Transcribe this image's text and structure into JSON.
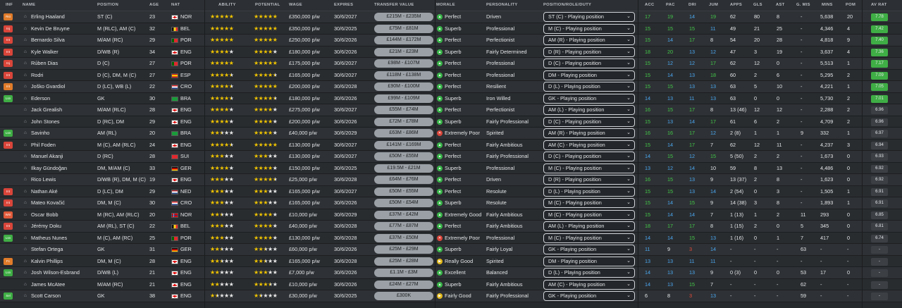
{
  "header": {
    "inf": "INF",
    "name": "NAME",
    "position": "POSITION",
    "age": "AGE",
    "nat": "NAT",
    "ability": "ABILITY",
    "potential": "POTENTIAL",
    "wage": "WAGE",
    "expires": "EXPIRES",
    "transfer_value": "TRANSFER VALUE",
    "morale": "MORALE",
    "personality": "PERSONALITY",
    "role": "POSITION/ROLE/DUTY",
    "acc": "ACC",
    "pac": "PAC",
    "dri": "DRI",
    "jum": "JUM",
    "apps": "APPS",
    "gls": "GLS",
    "ast": "AST",
    "gmis": "G. MIS",
    "mins": "MINS",
    "pom": "POM",
    "avrat": "AV RAT"
  },
  "colors": {
    "morale_green": "#3ab54a",
    "morale_red": "#d9453a",
    "morale_yellow": "#e0b81c",
    "rating_green": "#3fae45",
    "rating_light": "#7ac043"
  },
  "players": [
    {
      "inf": "Rst",
      "inf_color": "#e07b2a",
      "name": "Erling Haaland",
      "position": "ST (C)",
      "age": "23",
      "flag": "eng",
      "nat": "NOR",
      "ability": 5,
      "potential": 5,
      "wage": "£350,000 p/w",
      "expires": "30/6/2027",
      "tv": "£215M - £235M",
      "morale_icon": "green",
      "morale": "Perfect",
      "personality": "Driven",
      "role": "ST (C) - Playing position",
      "acc": "17",
      "acc_c": "g",
      "pac": "19",
      "pac_c": "g",
      "dri": "14",
      "dri_c": "b",
      "jum": "19",
      "jum_c": "g",
      "apps": "62",
      "gls": "80",
      "ast": "8",
      "gmis": "-",
      "mins": "5,638",
      "pom": "20",
      "avrat": "7.78",
      "av_c": "#3fae45"
    },
    {
      "inf": "Inj",
      "inf_color": "#d9453a",
      "name": "Kevin De Bruyne",
      "position": "M (RLC), AM (C)",
      "age": "32",
      "flag": "bel",
      "nat": "BEL",
      "ability": 5,
      "potential": 5,
      "wage": "£350,000 p/w",
      "expires": "30/6/2025",
      "tv": "£75M - £81M",
      "morale_icon": "green",
      "morale": "Superb",
      "personality": "Professional",
      "role": "M (C) - Playing position",
      "acc": "15",
      "acc_c": "g",
      "pac": "15",
      "pac_c": "g",
      "dri": "15",
      "dri_c": "g",
      "jum": "11",
      "jum_c": "b",
      "apps": "49",
      "gls": "21",
      "ast": "25",
      "gmis": "-",
      "mins": "4,346",
      "pom": "4",
      "avrat": "7.42",
      "av_c": "#3fae45"
    },
    {
      "inf": "Int",
      "inf_color": "#d9453a",
      "name": "Bernardo Silva",
      "position": "M/AM (RC)",
      "age": "29",
      "flag": "por",
      "nat": "POR",
      "ability": 5,
      "potential": 5,
      "wage": "£250,000 p/w",
      "expires": "30/6/2026",
      "tv": "£144M - £172M",
      "morale_icon": "green",
      "morale": "Perfect",
      "personality": "Perfectionist",
      "role": "AM (R) - Playing position",
      "acc": "15",
      "acc_c": "g",
      "pac": "14",
      "pac_c": "b",
      "dri": "17",
      "dri_c": "g",
      "jum": "8",
      "jum_c": "w",
      "apps": "54",
      "gls": "20",
      "ast": "28",
      "gmis": "-",
      "mins": "4,818",
      "pom": "9",
      "avrat": "7.40",
      "av_c": "#3fae45"
    },
    {
      "inf": "Int",
      "inf_color": "#d9453a",
      "name": "Kyle Walker",
      "position": "D/WB (R)",
      "age": "34",
      "flag": "eng",
      "nat": "ENG",
      "ability": 4,
      "potential": 4,
      "wage": "£180,000 p/w",
      "expires": "30/6/2026",
      "tv": "£21M - £23M",
      "morale_icon": "green",
      "morale": "Superb",
      "personality": "Fairly Determined",
      "role": "D (R) - Playing position",
      "acc": "18",
      "acc_c": "g",
      "pac": "20",
      "pac_c": "g",
      "dri": "13",
      "dri_c": "b",
      "jum": "12",
      "jum_c": "b",
      "apps": "47",
      "gls": "3",
      "ast": "19",
      "gmis": "-",
      "mins": "3,637",
      "pom": "4",
      "avrat": "7.36",
      "av_c": "#3fae45"
    },
    {
      "inf": "Inj",
      "inf_color": "#d9453a",
      "name": "Rúben Dias",
      "position": "D (C)",
      "age": "27",
      "flag": "por",
      "nat": "POR",
      "ability": 5,
      "potential": 5,
      "wage": "£175,000 p/w",
      "expires": "30/6/2027",
      "tv": "£98M - £107M",
      "morale_icon": "green",
      "morale": "Perfect",
      "personality": "Professional",
      "role": "D (C) - Playing position",
      "acc": "15",
      "acc_c": "g",
      "pac": "12",
      "pac_c": "b",
      "dri": "12",
      "dri_c": "b",
      "jum": "17",
      "jum_c": "g",
      "apps": "62",
      "gls": "12",
      "ast": "0",
      "gmis": "-",
      "mins": "5,513",
      "pom": "1",
      "avrat": "7.17",
      "av_c": "#3fae45"
    },
    {
      "inf": "Int",
      "inf_color": "#d9453a",
      "name": "Rodri",
      "position": "D (C), DM, M (C)",
      "age": "27",
      "flag": "esp",
      "nat": "ESP",
      "ability": 4.5,
      "potential": 4.5,
      "wage": "£165,000 p/w",
      "expires": "30/6/2027",
      "tv": "£118M - £138M",
      "morale_icon": "green",
      "morale": "Perfect",
      "personality": "Professional",
      "role": "DM - Playing position",
      "acc": "15",
      "acc_c": "g",
      "pac": "14",
      "pac_c": "b",
      "dri": "13",
      "dri_c": "b",
      "jum": "18",
      "jum_c": "g",
      "apps": "60",
      "gls": "2",
      "ast": "6",
      "gmis": "-",
      "mins": "5,295",
      "pom": "2",
      "avrat": "7.09",
      "av_c": "#3fae45"
    },
    {
      "inf": "Int",
      "inf_color": "#e07b2a",
      "name": "Joško Gvardiol",
      "position": "D (LC), WB (L)",
      "age": "22",
      "flag": "cro",
      "nat": "CRO",
      "ability": 4.5,
      "potential": 5,
      "wage": "£200,000 p/w",
      "expires": "30/6/2028",
      "tv": "£90M - £100M",
      "morale_icon": "green",
      "morale": "Perfect",
      "personality": "Resilient",
      "role": "D (L) - Playing position",
      "acc": "15",
      "acc_c": "g",
      "pac": "15",
      "pac_c": "g",
      "dri": "13",
      "dri_c": "b",
      "jum": "13",
      "jum_c": "b",
      "apps": "63",
      "gls": "5",
      "ast": "10",
      "gmis": "-",
      "mins": "4,221",
      "pom": "1",
      "avrat": "7.05",
      "av_c": "#3fae45"
    },
    {
      "inf": "Lsn",
      "inf_color": "#3fae45",
      "name": "Ederson",
      "position": "GK",
      "age": "30",
      "flag": "bra",
      "nat": "BRA",
      "ability": 4.5,
      "potential": 4.5,
      "wage": "£180,000 p/w",
      "expires": "30/6/2026",
      "tv": "£99M - £109M",
      "morale_icon": "green",
      "morale": "Superb",
      "personality": "Iron Willed",
      "role": "GK - Playing position",
      "acc": "14",
      "acc_c": "b",
      "pac": "13",
      "pac_c": "b",
      "dri": "11",
      "dri_c": "b",
      "jum": "13",
      "jum_c": "b",
      "apps": "63",
      "gls": "0",
      "ast": "0",
      "gmis": "-",
      "mins": "5,730",
      "pom": "2",
      "avrat": "7.01",
      "av_c": "#3fae45"
    },
    {
      "inf": "",
      "inf_color": "",
      "name": "Jack Grealish",
      "position": "M/AM (RLC)",
      "age": "28",
      "flag": "eng",
      "nat": "ENG",
      "ability": 4,
      "potential": 4,
      "wage": "£275,000 p/w",
      "expires": "30/6/2027",
      "tv": "£55M - £74M",
      "morale_icon": "green",
      "morale": "Perfect",
      "personality": "Perfectionist",
      "role": "AM (L) - Playing position",
      "acc": "16",
      "acc_c": "g",
      "pac": "15",
      "pac_c": "g",
      "dri": "17",
      "dri_c": "g",
      "jum": "8",
      "jum_c": "w",
      "apps": "13 (46)",
      "gls": "12",
      "ast": "12",
      "gmis": "-",
      "mins": "2,288",
      "pom": "2",
      "avrat": "6.96",
      "av_c": "#3c4045"
    },
    {
      "inf": "",
      "inf_color": "",
      "name": "John Stones",
      "position": "D (RC), DM",
      "age": "29",
      "flag": "eng",
      "nat": "ENG",
      "ability": 4,
      "potential": 4,
      "wage": "£200,000 p/w",
      "expires": "30/6/2026",
      "tv": "£72M - £78M",
      "morale_icon": "green",
      "morale": "Superb",
      "personality": "Fairly Professional",
      "role": "D (C) - Playing position",
      "acc": "15",
      "acc_c": "g",
      "pac": "13",
      "pac_c": "b",
      "dri": "14",
      "dri_c": "b",
      "jum": "17",
      "jum_c": "g",
      "apps": "61",
      "gls": "6",
      "ast": "2",
      "gmis": "-",
      "mins": "4,709",
      "pom": "2",
      "avrat": "6.96",
      "av_c": "#3c4045"
    },
    {
      "inf": "Lsn",
      "inf_color": "#3fae45",
      "name": "Savinho",
      "position": "AM (RL)",
      "age": "20",
      "flag": "bra",
      "nat": "BRA",
      "ability": 2.5,
      "potential": 4,
      "wage": "£40,000 p/w",
      "expires": "30/6/2029",
      "tv": "£63M - £86M",
      "morale_icon": "red",
      "morale": "Extremely Poor",
      "personality": "Spirited",
      "role": "AM (R) - Playing position",
      "acc": "16",
      "acc_c": "g",
      "pac": "16",
      "pac_c": "g",
      "dri": "17",
      "dri_c": "g",
      "jum": "12",
      "jum_c": "b",
      "apps": "2 (8)",
      "gls": "1",
      "ast": "1",
      "gmis": "9",
      "mins": "332",
      "pom": "1",
      "avrat": "6.97",
      "av_c": "#3c4045"
    },
    {
      "inf": "Int",
      "inf_color": "#d9453a",
      "name": "Phil Foden",
      "position": "M (C), AM (RLC)",
      "age": "24",
      "flag": "eng",
      "nat": "ENG",
      "ability": 4.5,
      "potential": 5,
      "wage": "£130,000 p/w",
      "expires": "30/6/2027",
      "tv": "£141M - £169M",
      "morale_icon": "green",
      "morale": "Perfect",
      "personality": "Fairly Ambitious",
      "role": "AM (C) - Playing position",
      "acc": "15",
      "acc_c": "g",
      "pac": "14",
      "pac_c": "b",
      "dri": "17",
      "dri_c": "g",
      "jum": "7",
      "jum_c": "w",
      "apps": "62",
      "gls": "12",
      "ast": "11",
      "gmis": "-",
      "mins": "4,237",
      "pom": "3",
      "avrat": "6.94",
      "av_c": "#3c4045"
    },
    {
      "inf": "",
      "inf_color": "",
      "name": "Manuel Akanji",
      "position": "D (RC)",
      "age": "28",
      "flag": "sui",
      "nat": "SUI",
      "ability": 3,
      "potential": 3,
      "wage": "£130,000 p/w",
      "expires": "30/6/2027",
      "tv": "£50M - £55M",
      "morale_icon": "green",
      "morale": "Perfect",
      "personality": "Fairly Professional",
      "role": "D (C) - Playing position",
      "acc": "14",
      "acc_c": "b",
      "pac": "15",
      "pac_c": "g",
      "dri": "12",
      "dri_c": "b",
      "jum": "15",
      "jum_c": "g",
      "apps": "5 (50)",
      "gls": "2",
      "ast": "2",
      "gmis": "-",
      "mins": "1,673",
      "pom": "0",
      "avrat": "6.93",
      "av_c": "#3c4045"
    },
    {
      "inf": "",
      "inf_color": "",
      "name": "Ilkay Gündoğan",
      "position": "DM, M/AM (C)",
      "age": "33",
      "flag": "ger",
      "nat": "GER",
      "ability": 4,
      "potential": 4,
      "wage": "£150,000 p/w",
      "expires": "30/6/2025",
      "tv": "£19.5M - £21M",
      "morale_icon": "green",
      "morale": "Superb",
      "personality": "Professional",
      "role": "M (C) - Playing position",
      "acc": "13",
      "acc_c": "b",
      "pac": "12",
      "pac_c": "b",
      "dri": "14",
      "dri_c": "b",
      "jum": "10",
      "jum_c": "w",
      "apps": "59",
      "gls": "8",
      "ast": "13",
      "gmis": "-",
      "mins": "4,486",
      "pom": "0",
      "avrat": "6.92",
      "av_c": "#3c4045"
    },
    {
      "inf": "",
      "inf_color": "",
      "name": "Rico Lewis",
      "position": "D/WB (R), DM, M (C)",
      "age": "19",
      "flag": "eng",
      "nat": "ENG",
      "ability": 3,
      "potential": 4.5,
      "wage": "£25,000 p/w",
      "expires": "30/6/2028",
      "tv": "£64M - £76M",
      "morale_icon": "green",
      "morale": "Perfect",
      "personality": "Driven",
      "role": "D (R) - Playing position",
      "acc": "16",
      "acc_c": "g",
      "pac": "15",
      "pac_c": "g",
      "dri": "13",
      "dri_c": "b",
      "jum": "9",
      "jum_c": "w",
      "apps": "13 (37)",
      "gls": "2",
      "ast": "8",
      "gmis": "-",
      "mins": "1,623",
      "pom": "0",
      "avrat": "6.92",
      "av_c": "#3c4045"
    },
    {
      "inf": "Int",
      "inf_color": "#d9453a",
      "name": "Nathan Aké",
      "position": "D (LC), DM",
      "age": "29",
      "flag": "ned",
      "nat": "NED",
      "ability": 3,
      "potential": 3,
      "wage": "£165,000 p/w",
      "expires": "30/6/2027",
      "tv": "£50M - £55M",
      "morale_icon": "green",
      "morale": "Perfect",
      "personality": "Resolute",
      "role": "D (L) - Playing position",
      "acc": "15",
      "acc_c": "g",
      "pac": "15",
      "pac_c": "g",
      "dri": "13",
      "dri_c": "b",
      "jum": "14",
      "jum_c": "b",
      "apps": "2 (54)",
      "gls": "0",
      "ast": "3",
      "gmis": "-",
      "mins": "1,505",
      "pom": "1",
      "avrat": "6.91",
      "av_c": "#3c4045"
    },
    {
      "inf": "Int",
      "inf_color": "#d9453a",
      "name": "Mateo Kovačić",
      "position": "DM, M (C)",
      "age": "30",
      "flag": "cro",
      "nat": "CRO",
      "ability": 3,
      "potential": 3,
      "wage": "£165,000 p/w",
      "expires": "30/6/2026",
      "tv": "£50M - £54M",
      "morale_icon": "green",
      "morale": "Superb",
      "personality": "Resolute",
      "role": "M (C) - Playing position",
      "acc": "15",
      "acc_c": "g",
      "pac": "14",
      "pac_c": "b",
      "dri": "15",
      "dri_c": "g",
      "jum": "9",
      "jum_c": "w",
      "apps": "14 (38)",
      "gls": "3",
      "ast": "8",
      "gmis": "-",
      "mins": "1,893",
      "pom": "1",
      "avrat": "6.91",
      "av_c": "#3c4045"
    },
    {
      "inf": "Wnt",
      "inf_color": "#e05a3a",
      "name": "Oscar Bobb",
      "position": "M (RC), AM (RLC)",
      "age": "20",
      "flag": "nor",
      "nat": "NOR",
      "ability": 2.5,
      "potential": 4,
      "wage": "£10,000 p/w",
      "expires": "30/6/2029",
      "tv": "£37M - £42M",
      "morale_icon": "green",
      "morale": "Extremely Good",
      "personality": "Fairly Ambitious",
      "role": "M (C) - Playing position",
      "acc": "15",
      "acc_c": "g",
      "pac": "14",
      "pac_c": "b",
      "dri": "14",
      "dri_c": "b",
      "jum": "7",
      "jum_c": "w",
      "apps": "1 (13)",
      "gls": "1",
      "ast": "2",
      "gmis": "11",
      "mins": "293",
      "pom": "0",
      "avrat": "6.85",
      "av_c": "#3c4045"
    },
    {
      "inf": "Int",
      "inf_color": "#d9453a",
      "name": "Jérémy Doku",
      "position": "AM (RL), ST (C)",
      "age": "22",
      "flag": "bel",
      "nat": "BEL",
      "ability": 3,
      "potential": 4,
      "wage": "£40,000 p/w",
      "expires": "30/6/2028",
      "tv": "£77M - £87M",
      "morale_icon": "green",
      "morale": "Perfect",
      "personality": "Fairly Ambitious",
      "role": "AM (L) - Playing position",
      "acc": "18",
      "acc_c": "g",
      "pac": "17",
      "pac_c": "g",
      "dri": "17",
      "dri_c": "g",
      "jum": "8",
      "jum_c": "w",
      "apps": "1 (15)",
      "gls": "2",
      "ast": "0",
      "gmis": "5",
      "mins": "345",
      "pom": "0",
      "avrat": "6.81",
      "av_c": "#3c4045"
    },
    {
      "inf": "Lsn",
      "inf_color": "#3fae45",
      "name": "Matheus Nunes",
      "position": "M (C), AM (RC)",
      "age": "25",
      "flag": "por",
      "nat": "POR",
      "ability": 3,
      "potential": 4,
      "wage": "£130,000 p/w",
      "expires": "30/6/2028",
      "tv": "£37M - £50M",
      "morale_icon": "red",
      "morale": "Extremely Poor",
      "personality": "Professional",
      "role": "M (C) - Playing position",
      "acc": "14",
      "acc_c": "b",
      "pac": "14",
      "pac_c": "b",
      "dri": "15",
      "dri_c": "g",
      "jum": "13",
      "jum_c": "b",
      "apps": "1 (16)",
      "gls": "0",
      "ast": "1",
      "gmis": "7",
      "mins": "417",
      "pom": "0",
      "avrat": "6.74",
      "av_c": "#3c4045"
    },
    {
      "inf": "",
      "inf_color": "",
      "name": "Stefan Ortega",
      "position": "GK",
      "age": "31",
      "flag": "ger",
      "nat": "GER",
      "ability": 2.5,
      "potential": 2.5,
      "wage": "£60,000 p/w",
      "expires": "30/6/2026",
      "tv": "£25M - £29M",
      "morale_icon": "green",
      "morale": "Superb",
      "personality": "Fairly Loyal",
      "role": "GK - Playing position",
      "acc": "11",
      "acc_c": "b",
      "pac": "9",
      "pac_c": "w",
      "dri": "3",
      "dri_c": "r",
      "jum": "14",
      "jum_c": "b",
      "apps": "-",
      "gls": "-",
      "ast": "-",
      "gmis": "63",
      "mins": "-",
      "pom": "-",
      "avrat": "-",
      "av_c": "#3c4045"
    },
    {
      "inf": "Fc",
      "inf_color": "#e07b2a",
      "name": "Kalvin Phillips",
      "position": "DM, M (C)",
      "age": "28",
      "flag": "eng",
      "nat": "ENG",
      "ability": 2.5,
      "potential": 2.5,
      "wage": "£165,000 p/w",
      "expires": "30/6/2028",
      "tv": "£25M - £28M",
      "morale_icon": "yellow",
      "morale": "Really Good",
      "personality": "Spirited",
      "role": "DM - Playing position",
      "acc": "13",
      "acc_c": "b",
      "pac": "13",
      "pac_c": "b",
      "dri": "11",
      "dri_c": "b",
      "jum": "11",
      "jum_c": "b",
      "apps": "-",
      "gls": "-",
      "ast": "-",
      "gmis": "-",
      "mins": "-",
      "pom": "-",
      "avrat": "-",
      "av_c": "#3c4045"
    },
    {
      "inf": "Lsn",
      "inf_color": "#3fae45",
      "name": "Josh Wilson-Esbrand",
      "position": "D/WB (L)",
      "age": "21",
      "flag": "eng",
      "nat": "ENG",
      "ability": 2,
      "potential": 3,
      "wage": "£7,000 p/w",
      "expires": "30/6/2026",
      "tv": "£1.1M - £3M",
      "morale_icon": "green",
      "morale": "Excellent",
      "personality": "Balanced",
      "role": "D (L) - Playing position",
      "acc": "14",
      "acc_c": "b",
      "pac": "13",
      "pac_c": "b",
      "dri": "13",
      "dri_c": "b",
      "jum": "9",
      "jum_c": "w",
      "apps": "0 (3)",
      "gls": "0",
      "ast": "0",
      "gmis": "53",
      "mins": "17",
      "pom": "0",
      "avrat": "-",
      "av_c": "#3c4045"
    },
    {
      "inf": "",
      "inf_color": "",
      "name": "James McAtee",
      "position": "M/AM (RC)",
      "age": "21",
      "flag": "eng",
      "nat": "ENG",
      "ability": 2,
      "potential": 3.5,
      "wage": "£10,000 p/w",
      "expires": "30/6/2026",
      "tv": "£24M - £27M",
      "morale_icon": "green",
      "morale": "Superb",
      "personality": "Fairly Ambitious",
      "role": "AM (C) - Playing position",
      "acc": "14",
      "acc_c": "b",
      "pac": "13",
      "pac_c": "b",
      "dri": "15",
      "dri_c": "g",
      "jum": "7",
      "jum_c": "w",
      "apps": "-",
      "gls": "-",
      "ast": "-",
      "gmis": "62",
      "mins": "-",
      "pom": "-",
      "avrat": "-",
      "av_c": "#3c4045"
    },
    {
      "inf": "Sel",
      "inf_color": "#3fae45",
      "name": "Scott Carson",
      "position": "GK",
      "age": "38",
      "flag": "eng",
      "nat": "ENG",
      "ability": 1.5,
      "potential": 1.5,
      "wage": "£30,000 p/w",
      "expires": "30/6/2025",
      "tv": "£300K",
      "morale_icon": "yellow",
      "morale": "Fairly Good",
      "personality": "Fairly Professional",
      "role": "GK - Playing position",
      "acc": "6",
      "acc_c": "w",
      "pac": "8",
      "pac_c": "w",
      "dri": "3",
      "dri_c": "r",
      "jum": "13",
      "jum_c": "b",
      "apps": "-",
      "gls": "-",
      "ast": "-",
      "gmis": "59",
      "mins": "-",
      "pom": "-",
      "avrat": "-",
      "av_c": "#3c4045"
    }
  ]
}
